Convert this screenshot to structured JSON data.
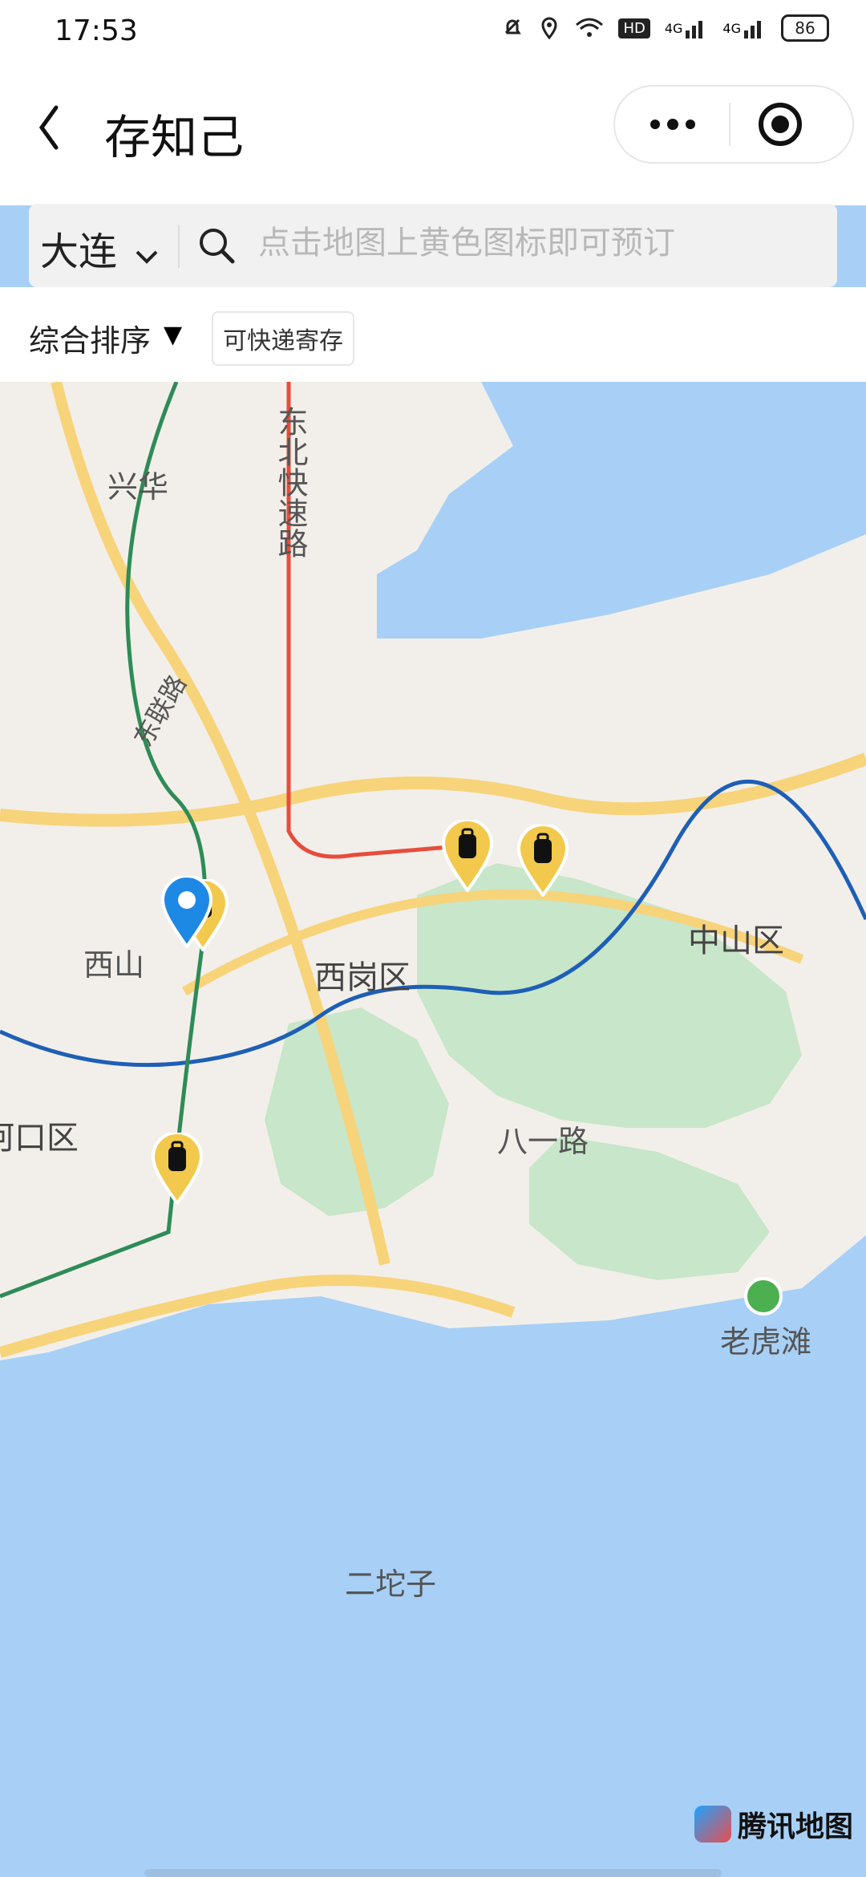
{
  "status": {
    "time": "17:53",
    "battery": "86",
    "network_labels": [
      "HD",
      "4G",
      "4G"
    ]
  },
  "header": {
    "title": "存知己"
  },
  "search": {
    "city": "大连",
    "placeholder": "点击地图上黄色图标即可预订"
  },
  "filters": {
    "sort_label": "综合排序",
    "sort_indicator": "▼",
    "express_chip": "可快递寄存"
  },
  "map": {
    "labels": {
      "xinghua": "兴华",
      "dongbei_expressway": "东北快速路",
      "dongfu_road": "东联路",
      "xishan": "西山",
      "xigang": "西岗区",
      "zhongshan": "中山区",
      "hekou": "河口区",
      "bayi_road": "八一路",
      "laohutan": "老虎滩",
      "ertuozi": "二坨子"
    },
    "provider": "腾讯地图",
    "colors": {
      "water": "#a8d0f6",
      "land": "#f2efea",
      "park": "#c8e6c9",
      "road": "#f7d37a",
      "pin": "#f2c94c",
      "location": "#1e88e5"
    }
  }
}
